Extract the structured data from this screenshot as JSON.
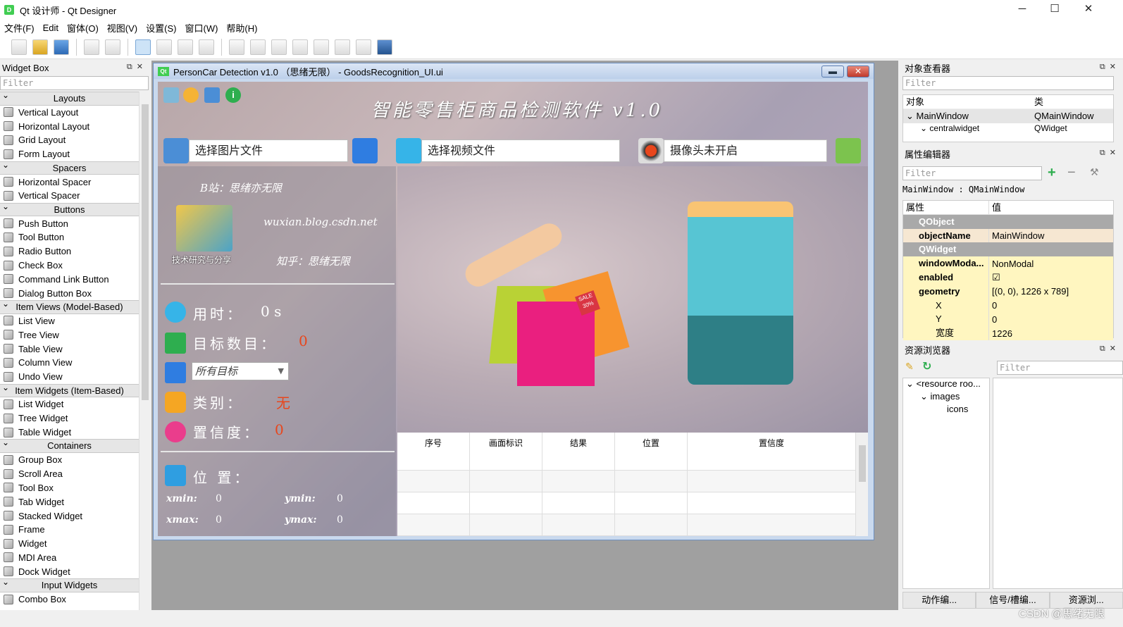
{
  "window": {
    "title": "Qt 设计师 - Qt Designer",
    "controls": [
      "─",
      "☐",
      "✕"
    ]
  },
  "menubar": [
    "文件(F)",
    "Edit",
    "窗体(O)",
    "视图(V)",
    "设置(S)",
    "窗口(W)",
    "帮助(H)"
  ],
  "widget_box": {
    "title": "Widget Box",
    "filter_placeholder": "Filter",
    "categories": [
      {
        "label": "Layouts",
        "items": [
          "Vertical Layout",
          "Horizontal Layout",
          "Grid Layout",
          "Form Layout"
        ]
      },
      {
        "label": "Spacers",
        "items": [
          "Horizontal Spacer",
          "Vertical Spacer"
        ]
      },
      {
        "label": "Buttons",
        "items": [
          "Push Button",
          "Tool Button",
          "Radio Button",
          "Check Box",
          "Command Link Button",
          "Dialog Button Box"
        ]
      },
      {
        "label": "Item Views (Model-Based)",
        "items": [
          "List View",
          "Tree View",
          "Table View",
          "Column View",
          "Undo View"
        ]
      },
      {
        "label": "Item Widgets (Item-Based)",
        "items": [
          "List Widget",
          "Tree Widget",
          "Table Widget"
        ]
      },
      {
        "label": "Containers",
        "items": [
          "Group Box",
          "Scroll Area",
          "Tool Box",
          "Tab Widget",
          "Stacked Widget",
          "Frame",
          "Widget",
          "MDI Area",
          "Dock Widget"
        ]
      },
      {
        "label": "Input Widgets",
        "items": [
          "Combo Box"
        ]
      }
    ]
  },
  "form": {
    "window_title": "PersonCar Detection v1.0 （思绪无限） - GoodsRecognition_UI.ui",
    "heading": "智能零售柜商品检测软件 v1.0",
    "image_input": "选择图片文件",
    "video_input": "选择视频文件",
    "camera_input": "摄像头未开启",
    "bilibili": "B站：思绪亦无限",
    "blog": "wuxian.blog.csdn.net",
    "zhihu": "知乎：思绪无限",
    "logo_caption": "技术研究与分享",
    "time_label": "用时：",
    "time_value": "0 s",
    "count_label": "目标数目：",
    "count_value": "0",
    "target_combo": "所有目标",
    "class_label": "类别：",
    "class_value": "无",
    "conf_label": "置信度：",
    "conf_value": "0",
    "position_label": "位 置：",
    "xmin_label": "xmin:",
    "xmin_value": "0",
    "ymin_label": "ymin:",
    "ymin_value": "0",
    "xmax_label": "xmax:",
    "xmax_value": "0",
    "ymax_label": "ymax:",
    "ymax_value": "0",
    "sale_tag": "SALE 30%",
    "table_headers": [
      "序号",
      "画面标识",
      "结果",
      "位置",
      "置信度"
    ],
    "table_rows": 3
  },
  "object_inspector": {
    "title": "对象查看器",
    "filter_placeholder": "Filter",
    "col_object": "对象",
    "col_class": "类",
    "rows": [
      {
        "object": "MainWindow",
        "class": "QMainWindow"
      },
      {
        "object": "centralwidget",
        "class": "QWidget"
      }
    ]
  },
  "property_editor": {
    "title": "属性编辑器",
    "filter_placeholder": "Filter",
    "context": "MainWindow : QMainWindow",
    "col_property": "属性",
    "col_value": "值",
    "rows": [
      {
        "name": "QObject",
        "value": "",
        "kind": "group"
      },
      {
        "name": "objectName",
        "value": "MainWindow",
        "kind": "beige"
      },
      {
        "name": "QWidget",
        "value": "",
        "kind": "group"
      },
      {
        "name": "windowModa...",
        "value": "NonModal",
        "kind": "yellow"
      },
      {
        "name": "enabled",
        "value": "☑",
        "kind": "yellow"
      },
      {
        "name": "geometry",
        "value": "[(0, 0), 1226 x 789]",
        "kind": "yellow"
      },
      {
        "name": "X",
        "value": "0",
        "kind": "yellow-sub"
      },
      {
        "name": "Y",
        "value": "0",
        "kind": "yellow-sub"
      },
      {
        "name": "宽度",
        "value": "1226",
        "kind": "yellow-sub"
      }
    ]
  },
  "resource_browser": {
    "title": "资源浏览器",
    "filter_placeholder": "Filter",
    "tree": [
      "<resource roo...",
      "images",
      "icons"
    ]
  },
  "bottom_tabs": [
    "动作编...",
    "信号/槽编...",
    "资源浏..."
  ],
  "watermark": "CSDN @思绪无限",
  "colors": {
    "accent_red": "#e8461c",
    "form_title": "#bcd0ea",
    "prop_yellow": "#fff6c0"
  }
}
